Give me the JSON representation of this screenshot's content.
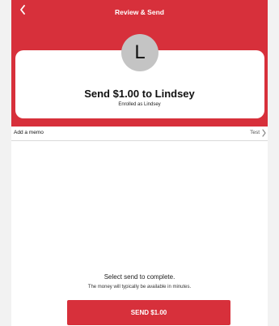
{
  "header": {
    "title": "Review & Send",
    "back_icon": "chevron-left-icon"
  },
  "recipient": {
    "avatar_initial": "L",
    "send_text": "Send $1.00 to Lindsey",
    "enrolled_text": "Enrolled as Lindsey"
  },
  "memo": {
    "label": "Add a memo",
    "value": "Test",
    "chevron_icon": "chevron-right-icon"
  },
  "footer": {
    "instruction": "Select send to complete.",
    "availability": "The money will typically be available in minutes.",
    "send_button_label": "SEND $1.00"
  },
  "colors": {
    "brand_red": "#d7303b",
    "avatar_gray": "#c4c4c4",
    "background": "#ffffff"
  }
}
